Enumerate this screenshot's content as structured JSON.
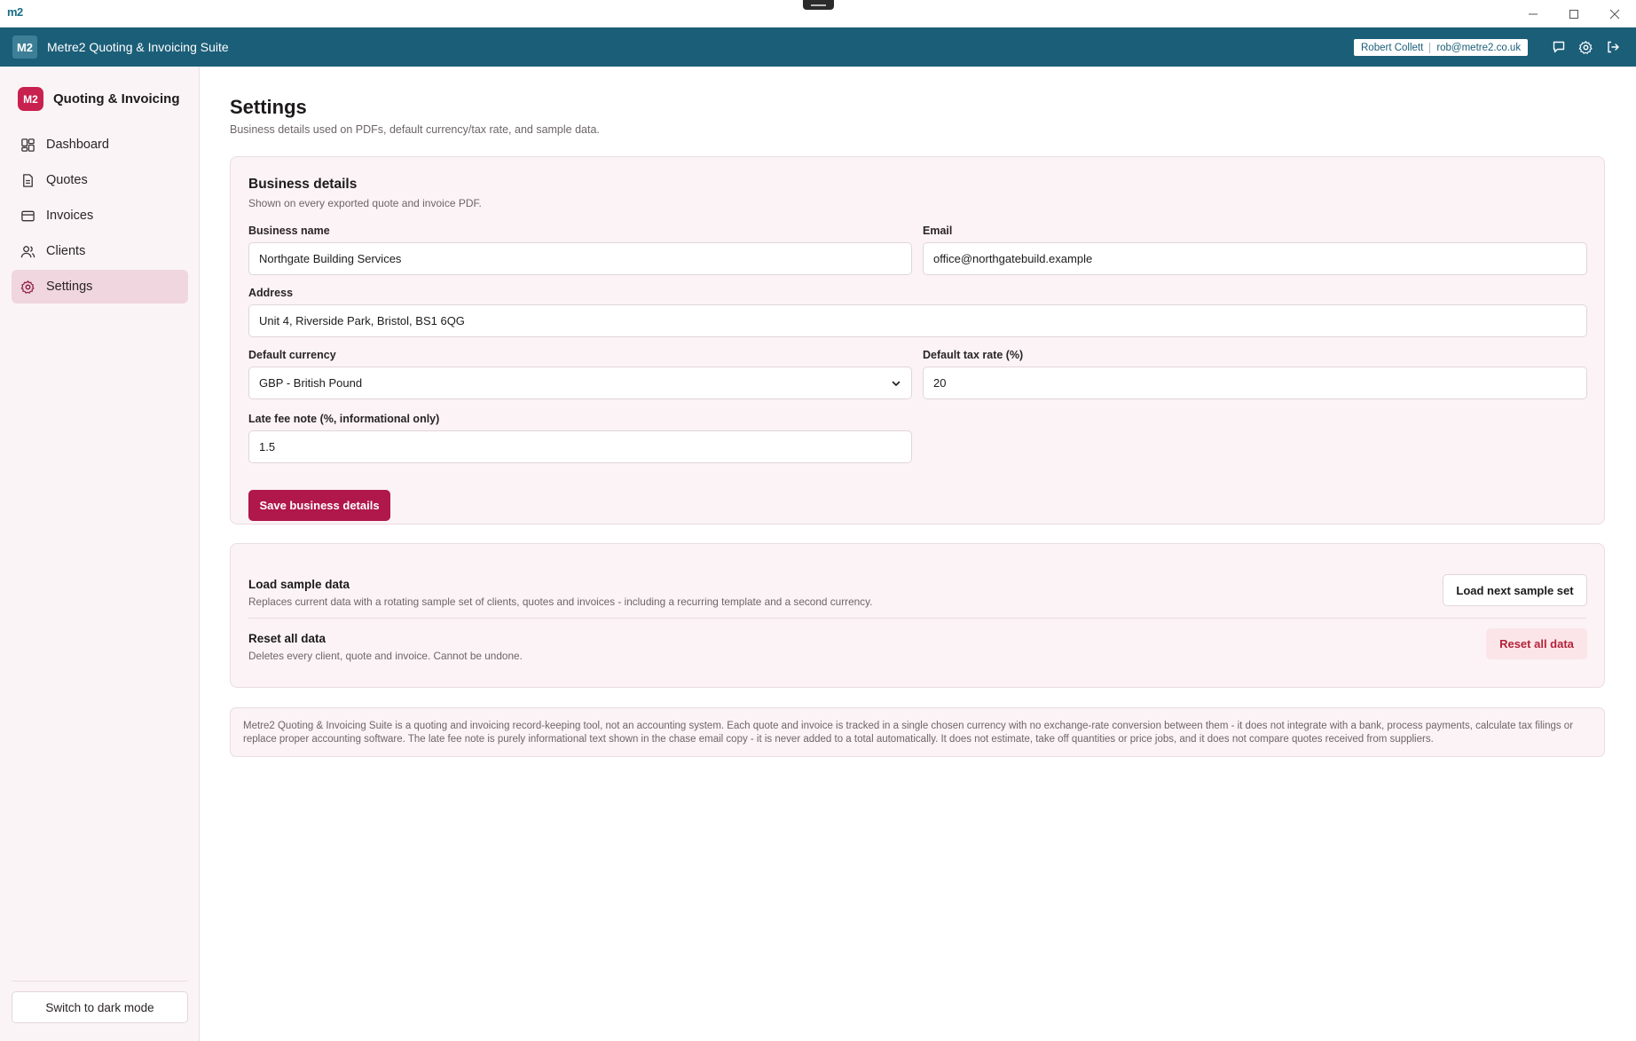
{
  "window": {
    "logo_text": "m2",
    "controls": [
      "minimize-icon",
      "maximize-icon",
      "close-icon"
    ]
  },
  "appbar": {
    "badge": "M2",
    "title": "Metre2 Quoting & Invoicing Suite",
    "user_name": "Robert Collett",
    "user_email": "rob@metre2.co.uk",
    "icons": [
      "chat-icon",
      "gear-icon",
      "logout-icon"
    ],
    "color": "#1b5e78"
  },
  "sidebar": {
    "brand_badge": "M2",
    "brand_name": "Quoting & Invoicing",
    "items": [
      {
        "label": "Dashboard",
        "icon": "dashboard-icon",
        "active": false
      },
      {
        "label": "Quotes",
        "icon": "document-icon",
        "active": false
      },
      {
        "label": "Invoices",
        "icon": "invoice-icon",
        "active": false
      },
      {
        "label": "Clients",
        "icon": "users-icon",
        "active": false
      },
      {
        "label": "Settings",
        "icon": "gear-icon",
        "active": true
      }
    ],
    "dark_mode_label": "Switch to dark mode"
  },
  "page": {
    "title": "Settings",
    "subtitle": "Business details used on PDFs, default currency/tax rate, and sample data."
  },
  "business": {
    "title": "Business details",
    "subtitle": "Shown on every exported quote and invoice PDF.",
    "name_label": "Business name",
    "name_value": "Northgate Building Services",
    "email_label": "Email",
    "email_value": "office@northgatebuild.example",
    "address_label": "Address",
    "address_value": "Unit 4, Riverside Park, Bristol, BS1 6QG",
    "currency_label": "Default currency",
    "currency_value": "GBP - British Pound",
    "tax_label": "Default tax rate (%)",
    "tax_value": "20",
    "late_fee_label": "Late fee note (%, informational only)",
    "late_fee_value": "1.5",
    "save_label": "Save business details",
    "accent": "#b0174a"
  },
  "data_tools": {
    "load_title": "Load sample data",
    "load_desc": "Replaces current data with a rotating sample set of clients, quotes and invoices - including a recurring template and a second currency.",
    "load_button": "Load next sample set",
    "reset_title": "Reset all data",
    "reset_desc": "Deletes every client, quote and invoice. Cannot be undone.",
    "reset_button": "Reset all data",
    "danger_color": "#b3243a"
  },
  "disclaimer": "Metre2 Quoting & Invoicing Suite is a quoting and invoicing record-keeping tool, not an accounting system. Each quote and invoice is tracked in a single chosen currency with no exchange-rate conversion between them - it does not integrate with a bank, process payments, calculate tax filings or replace proper accounting software. The late fee note is purely informational text shown in the chase email copy - it is never added to a total automatically. It does not estimate, take off quantities or price jobs, and it does not compare quotes received from suppliers."
}
